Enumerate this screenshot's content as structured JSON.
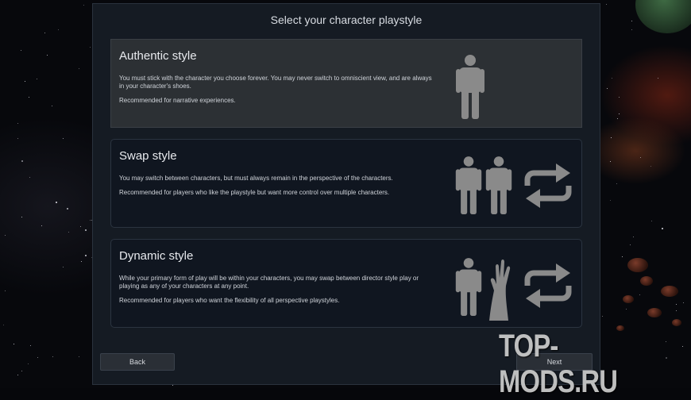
{
  "screen": {
    "title": "Select your character playstyle"
  },
  "cards": [
    {
      "title": "Authentic style",
      "desc1": "You must stick with the character you choose forever. You may never switch to omniscient view, and are always in your character's shoes.",
      "desc2": "Recommended for narrative experiences.",
      "icons": [
        "person-icon"
      ],
      "selected": true
    },
    {
      "title": "Swap style",
      "desc1": "You may switch between characters, but must always remain in the perspective of the characters.",
      "desc2": "Recommended for players who like the playstyle but want more control over multiple characters.",
      "icons": [
        "person-icon",
        "person-icon",
        "swap-arrows-icon"
      ],
      "selected": false
    },
    {
      "title": "Dynamic style",
      "desc1": "While your primary form of play will be within your characters, you may swap between director style play or playing as any of your characters at any point.",
      "desc2": "Recommended for players who want the flexibility of all perspective playstyles.",
      "icons": [
        "person-icon",
        "director-hand-icon",
        "swap-arrows-icon"
      ],
      "selected": false
    }
  ],
  "buttons": {
    "back": "Back",
    "next": "Next"
  },
  "watermark": "TOP-MODS.RU",
  "colors": {
    "panel": "#151b23",
    "card": "#101620",
    "card_selected": "#2c3034",
    "icon": "#8a8a8a"
  }
}
